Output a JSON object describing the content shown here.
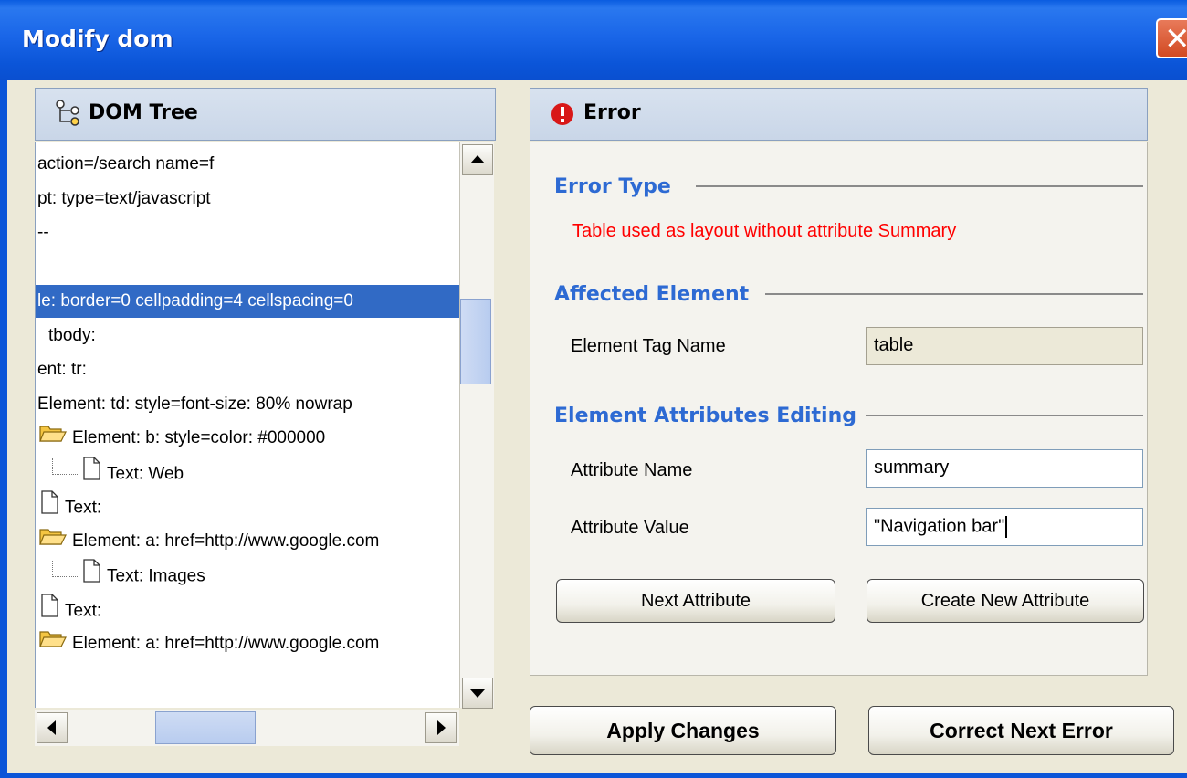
{
  "window": {
    "title": "Modify dom",
    "close_glyph": "✕"
  },
  "tree_panel": {
    "title": "DOM Tree",
    "rows": [
      {
        "text": "action=/search  name=f",
        "icon": "none",
        "indent": 0,
        "selected": false
      },
      {
        "text": "pt:  type=text/javascript",
        "icon": "none",
        "indent": 0,
        "selected": false
      },
      {
        "text": "--",
        "icon": "none",
        "indent": 0,
        "selected": false
      },
      {
        "text": "",
        "icon": "none",
        "indent": 0,
        "selected": false
      },
      {
        "text": "le:  border=0  cellpadding=4  cellspacing=0",
        "icon": "none",
        "indent": 0,
        "selected": true
      },
      {
        "text": "tbody:",
        "icon": "none",
        "indent": 0,
        "selected": false
      },
      {
        "text": "ent: tr:",
        "icon": "none",
        "indent": 0,
        "selected": false
      },
      {
        "text": "Element: td:  style=font-size: 80%  nowrap",
        "icon": "none",
        "indent": 0,
        "selected": false
      },
      {
        "text": "Element: b:  style=color: #000000",
        "icon": "folder-open",
        "indent": 0,
        "selected": false
      },
      {
        "text": "Text: Web",
        "icon": "file",
        "indent": 1,
        "selected": false
      },
      {
        "text": "Text:",
        "icon": "file",
        "indent": 0,
        "selected": false
      },
      {
        "text": "Element: a:  href=http://www.google.com",
        "icon": "folder-open",
        "indent": 0,
        "selected": false
      },
      {
        "text": "Text: Images",
        "icon": "file",
        "indent": 1,
        "selected": false
      },
      {
        "text": "Text:",
        "icon": "file",
        "indent": 0,
        "selected": false
      },
      {
        "text": "Element: a:  href=http://www.google.com",
        "icon": "folder-open",
        "indent": 0,
        "selected": false
      }
    ]
  },
  "error_panel": {
    "title": "Error",
    "error_type": {
      "heading": "Error Type",
      "message": "Table used as layout without attribute Summary"
    },
    "affected_element": {
      "heading": "Affected Element",
      "tag_label": "Element Tag Name",
      "tag_value": "table"
    },
    "attributes_editing": {
      "heading": "Element Attributes Editing",
      "name_label": "Attribute Name",
      "name_value": "summary",
      "value_label": "Attribute Value",
      "value_value": "\"Navigation bar\""
    },
    "next_attribute_button": "Next Attribute",
    "create_attribute_button": "Create New Attribute"
  },
  "footer": {
    "apply_button": "Apply Changes",
    "correct_next_button": "Correct Next Error"
  },
  "colors": {
    "title_bar": "#0b55d8",
    "selection": "#316ac5",
    "section_heading": "#2d6ad3",
    "error_text": "#ff0000"
  }
}
